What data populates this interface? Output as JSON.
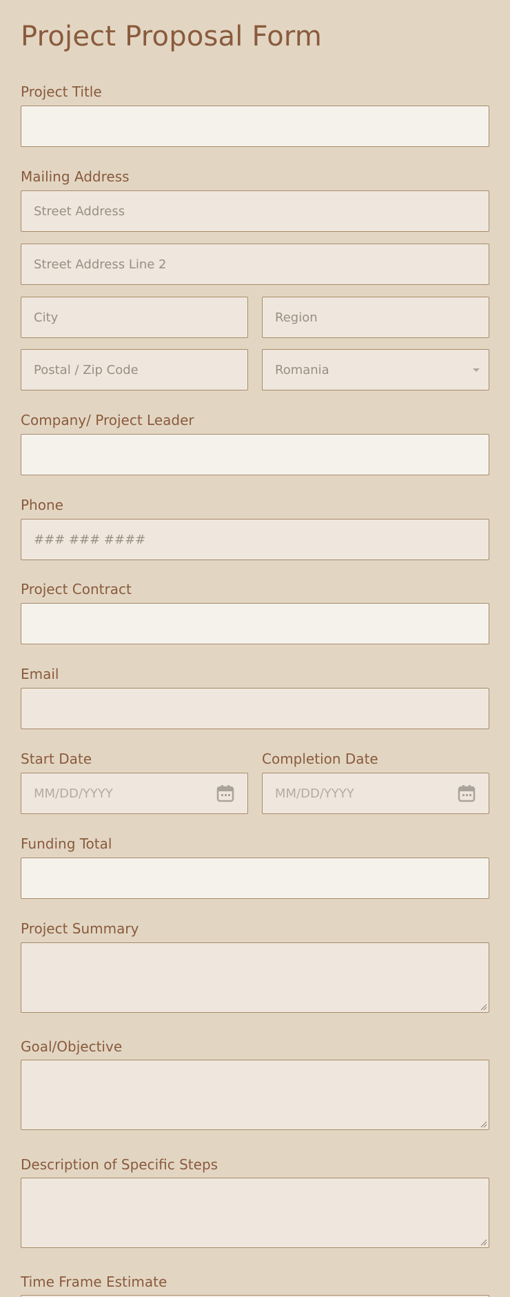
{
  "form": {
    "title": "Project Proposal Form",
    "project_title": {
      "label": "Project Title",
      "value": ""
    },
    "mailing_address": {
      "label": "Mailing Address",
      "street_placeholder": "Street Address",
      "street2_placeholder": "Street Address Line 2",
      "city_placeholder": "City",
      "region_placeholder": "Region",
      "postal_placeholder": "Postal / Zip Code",
      "country_selected": "Romania"
    },
    "leader": {
      "label": "Company/ Project Leader",
      "value": ""
    },
    "phone": {
      "label": "Phone",
      "placeholder": "### ### ####"
    },
    "contract": {
      "label": "Project Contract",
      "value": ""
    },
    "email": {
      "label": "Email",
      "value": ""
    },
    "start_date": {
      "label": "Start Date",
      "placeholder": "MM/DD/YYYY"
    },
    "completion_date": {
      "label": "Completion Date",
      "placeholder": "MM/DD/YYYY"
    },
    "funding": {
      "label": "Funding Total",
      "value": ""
    },
    "summary": {
      "label": "Project Summary"
    },
    "goal": {
      "label": "Goal/Objective"
    },
    "steps": {
      "label": "Description of Specific Steps"
    },
    "timeframe": {
      "label": "Time Frame Estimate"
    }
  },
  "icons": {
    "calendar": "calendar-icon",
    "dropdown": "chevron-down-icon",
    "resize": "resize-grip-icon"
  },
  "colors": {
    "background": "#e2d6c3",
    "label": "#8a5a3c",
    "input_light": "#f5f2ec",
    "input_mid": "#efe7dd",
    "border": "#a78a68"
  }
}
